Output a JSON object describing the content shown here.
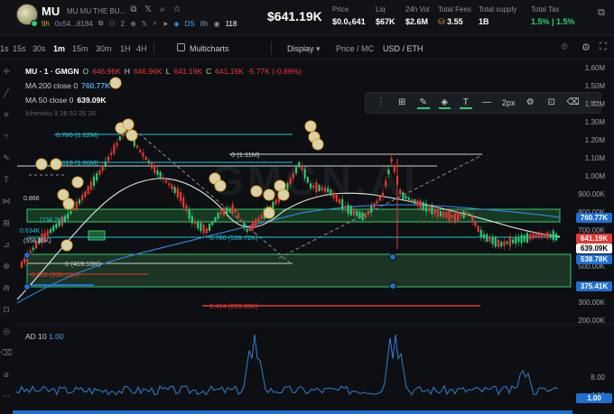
{
  "header": {
    "ticker": "MU",
    "full_name": "MU MU THE BU...",
    "age": "9h",
    "address": "0x54...8184",
    "holders_small": "2",
    "ds_label": "DS",
    "ds_time": "8h",
    "views": "118",
    "price_big": "$641.19K",
    "stats": [
      {
        "label": "Price",
        "value": "$0.0₆641"
      },
      {
        "label": "Liq",
        "value": "$67K"
      },
      {
        "label": "24h Vol",
        "value": "$2.6M"
      },
      {
        "label": "Total Fees",
        "value": "3.55"
      },
      {
        "label": "Total supply",
        "value": "1B"
      },
      {
        "label": "Total Tax",
        "value": "1.5% | 1.5%"
      }
    ]
  },
  "toolbar": {
    "timeframes": [
      "1s",
      "15s",
      "30s",
      "1m",
      "15m",
      "30m",
      "1H",
      "4H"
    ],
    "active_timeframe": "1m",
    "multicharts": "Multicharts",
    "display": "Display",
    "price_mc": "Price / MC",
    "usd_eth": "USD / ETH"
  },
  "legend": {
    "symbol": "MU · 1 · GMGN",
    "o_key": "O",
    "o": "646.96K",
    "h_key": "H",
    "h": "646.96K",
    "l_key": "L",
    "l": "641.19K",
    "c_key": "C",
    "c": "641.19K",
    "change": "-5.77K (-0.89%)",
    "ma200_label": "MA 200 close 0",
    "ma200": "760.77K",
    "ma50_label": "MA 50 close 0",
    "ma50": "639.09K",
    "ichimoku": "Ichimoku 9 26 52 26 26"
  },
  "drawbar": {
    "width_label": "2px"
  },
  "axis": {
    "ticks": [
      "1.60M",
      "1.50M",
      "1.40M",
      "1.30M",
      "1.20M",
      "1.10M",
      "1.00M",
      "900.00K",
      "800.00K",
      "700.00K",
      "600.00K",
      "500.00K",
      "400.00K",
      "300.00K",
      "200.00K"
    ],
    "boxes": [
      {
        "text": "760.77K",
        "bg": "#1f6fd1",
        "fg": "#ffffff"
      },
      {
        "text": "641.19K",
        "bg": "#e53935",
        "fg": "#ffffff"
      },
      {
        "text": "639.09K",
        "bg": "#ffffff",
        "fg": "#000000"
      },
      {
        "text": "538.78K",
        "bg": "#1f6fd1",
        "fg": "#ffffff"
      },
      {
        "text": "375.41K",
        "bg": "#1f6fd1",
        "fg": "#ffffff"
      }
    ],
    "ad_ticks": [
      "8.00",
      "4.00"
    ],
    "ad_box": "1.00"
  },
  "fib": {
    "f0786": "0.786 (1.22M)",
    "f0": "0 (1.11M)",
    "f0618": "0.618 (1.06M)",
    "f0786b": "0.786 (539.72K)",
    "f0b": "0 (469.53K)",
    "f0382b": "0.382 (338.51K)",
    "f1414": "1.414 (259.68K)",
    "frag_866": "0.866",
    "frag_734": "(734.2K)",
    "frag_634": "0.634K",
    "frag_558": "(558.86K)"
  },
  "ad": {
    "label": "AD 10",
    "value": "1.00"
  },
  "watermark": "GMGN.AI",
  "colors": {
    "green": "#2ecc71",
    "red": "#e53935",
    "blue": "#1f6fd1",
    "cyan": "#19c6d9",
    "ma200": "#2f7fd6",
    "ma50": "#e8e8e8"
  }
}
